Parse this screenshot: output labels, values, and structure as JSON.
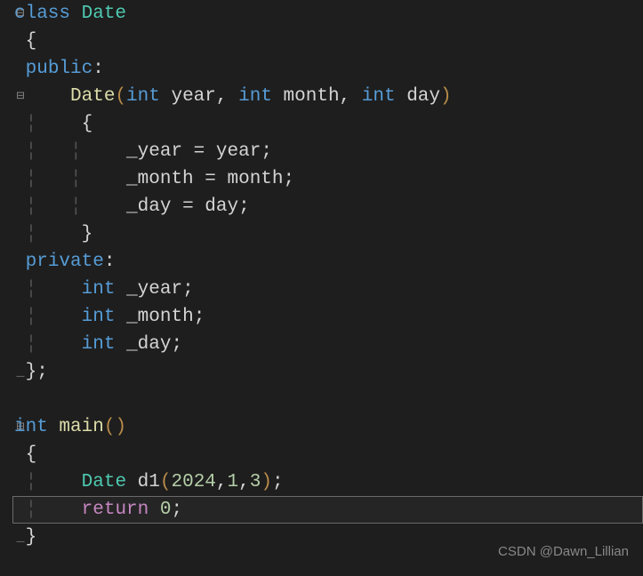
{
  "watermark": "CSDN @Dawn_Lillian",
  "code": {
    "class_kw": "class",
    "class_name": "Date",
    "open_brace_1": " {",
    "public_kw": "public",
    "colon1": ":",
    "ctor_name": "Date",
    "lparen": "(",
    "int_kw": "int",
    "param_year": "year",
    "comma": ",",
    "param_month": "month",
    "param_day": "day",
    "rparen": ")",
    "open_brace_2": "    {",
    "assign_year_lhs": "_year",
    "eq": "=",
    "assign_year_rhs": "year",
    "semi": ";",
    "assign_month_lhs": "_month",
    "assign_month_rhs": "month",
    "assign_day_lhs": "_day",
    "assign_day_rhs": "day",
    "close_brace_2": "    }",
    "private_kw": "private",
    "colon2": ":",
    "int_kw2": "int",
    "field_year": "_year",
    "field_month": "_month",
    "field_day": "_day",
    "close_brace_1": " }",
    "main_name": "main",
    "lparen_main": "(",
    "rparen_main": ")",
    "open_brace_main": " {",
    "date_type": "Date",
    "d1": "d1",
    "arg_2024": "2024",
    "arg_1": "1",
    "arg_3": "3",
    "return_kw": "return",
    "zero": "0",
    "close_brace_main": " }"
  }
}
